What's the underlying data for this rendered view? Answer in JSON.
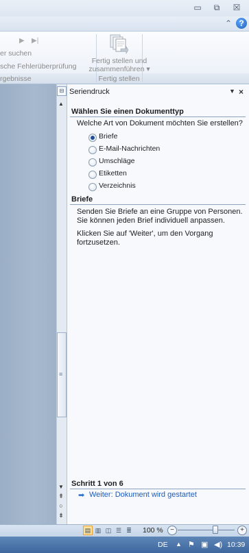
{
  "window": {
    "minimize": "▭",
    "maximize": "⧉",
    "close": "☒"
  },
  "ribbon": {
    "nav_next": "▶",
    "nav_last": "▶|",
    "suchen": "er suchen",
    "fehler": "sche Fehlerüberprüfung",
    "ergebnisse": "rgebnisse",
    "merge_label_1": "Fertig stellen und",
    "merge_label_2": "zusammenführen ▾",
    "group_label": "Fertig stellen",
    "collapse": "⌃",
    "help": "?"
  },
  "pane": {
    "title": "Seriendruck",
    "menu": "▼",
    "close": "×",
    "section1_title": "Wählen Sie einen Dokumenttyp",
    "question": "Welche Art von Dokument möchten Sie erstellen?",
    "options": [
      {
        "label": "Briefe",
        "selected": true
      },
      {
        "label": "E-Mail-Nachrichten",
        "selected": false
      },
      {
        "label": "Umschläge",
        "selected": false
      },
      {
        "label": "Etiketten",
        "selected": false
      },
      {
        "label": "Verzeichnis",
        "selected": false
      }
    ],
    "section2_title": "Briefe",
    "desc1": "Senden Sie Briefe an eine Gruppe von Personen. Sie können jeden Brief individuell anpassen.",
    "desc2": "Klicken Sie auf 'Weiter', um den Vorgang fortzusetzen.",
    "step_title": "Schritt 1 von 6",
    "next_link": "Weiter: Dokument wird gestartet"
  },
  "statusbar": {
    "zoom": "100 %",
    "zoom_minus": "−",
    "zoom_plus": "+",
    "zoom_level": 0.66
  },
  "taskbar": {
    "lang": "DE",
    "clock": "10:39"
  },
  "colors": {
    "accent": "#1a5bbf",
    "taskbar": "#4a74aa"
  }
}
